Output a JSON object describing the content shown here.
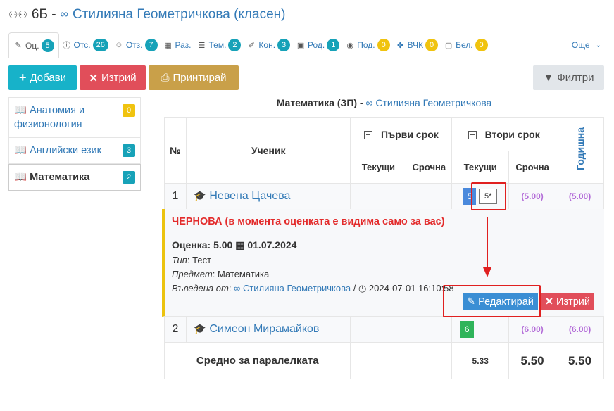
{
  "header": {
    "class_name": "6Б -",
    "teacher": "Стилияна Геометричкова (класен)"
  },
  "tabs": [
    {
      "label": "Оц.",
      "count": "5",
      "icon": "pencil-icon",
      "badge": "teal",
      "active": true
    },
    {
      "label": "Отс.",
      "count": "26",
      "icon": "info-circle-icon",
      "badge": "teal"
    },
    {
      "label": "Отз.",
      "count": "7",
      "icon": "users-icon",
      "badge": "teal"
    },
    {
      "label": "Раз.",
      "count": "",
      "icon": "table-icon"
    },
    {
      "label": "Тем.",
      "count": "2",
      "icon": "list-icon",
      "badge": "teal"
    },
    {
      "label": "Кон.",
      "count": "3",
      "icon": "edit-icon",
      "badge": "teal"
    },
    {
      "label": "Род.",
      "count": "1",
      "icon": "calendar-icon",
      "badge": "teal"
    },
    {
      "label": "Под.",
      "count": "0",
      "icon": "eye-icon",
      "badge": "yellow"
    },
    {
      "label": "ВЧК",
      "count": "0",
      "icon": "handshake-icon",
      "badge": "yellow"
    },
    {
      "label": "Бел.",
      "count": "0",
      "icon": "note-icon",
      "badge": "yellow"
    }
  ],
  "more_label": "Още",
  "toolbar": {
    "add": "Добави",
    "delete": "Изтрий",
    "print": "Принтирай",
    "filters": "Филтри"
  },
  "subjects": [
    {
      "name": "Анатомия и физионология",
      "count": "0",
      "badge": "yellow"
    },
    {
      "name": "Английски език",
      "count": "3",
      "badge": "teal"
    },
    {
      "name": "Математика",
      "count": "2",
      "badge": "teal",
      "active": true
    }
  ],
  "grades_title": {
    "subject": "Математика (ЗП) -",
    "teacher": "Стилияна Геометричкова"
  },
  "table": {
    "col_no": "№",
    "col_student": "Ученик",
    "term1": "Първи срок",
    "term2": "Втори срок",
    "annual": "Годишна",
    "current": "Текущи",
    "term_grade": "Срочна",
    "rows": [
      {
        "no": "1",
        "name": "Невена Цачева",
        "grades": [
          "5",
          "5*"
        ],
        "term2_term": "(5.00)",
        "annual": "(5.00)"
      },
      {
        "no": "2",
        "name": "Симеон Мирамайков",
        "grades": [
          "6"
        ],
        "term2_term": "(6.00)",
        "annual": "(6.00)"
      }
    ],
    "average_label": "Средно за паралелката",
    "average": {
      "current": "5.33",
      "term": "5.50",
      "annual": "5.50"
    }
  },
  "draft": {
    "warning": "ЧЕРНОВА (в момента оценката е видима само за вас)",
    "grade_label": "Оценка:",
    "grade_value": "5.00",
    "date": "01.07.2024",
    "type_label": "Тип",
    "type_value": ": Тест",
    "subject_label": "Предмет",
    "subject_value": ": Математика",
    "entered_label": "Въведена от",
    "entered_by": "Стилияна Геометричкова",
    "entered_at": "2024-07-01 16:10:58",
    "edit_button": "Редактирай",
    "delete_button": "Изтрий"
  },
  "colors": {
    "accent": "#337ab7",
    "teal": "#17b2c9",
    "danger": "#e14e5a",
    "gold": "#c9a049",
    "draft_border": "#ecc30e",
    "highlight": "#e02020"
  }
}
